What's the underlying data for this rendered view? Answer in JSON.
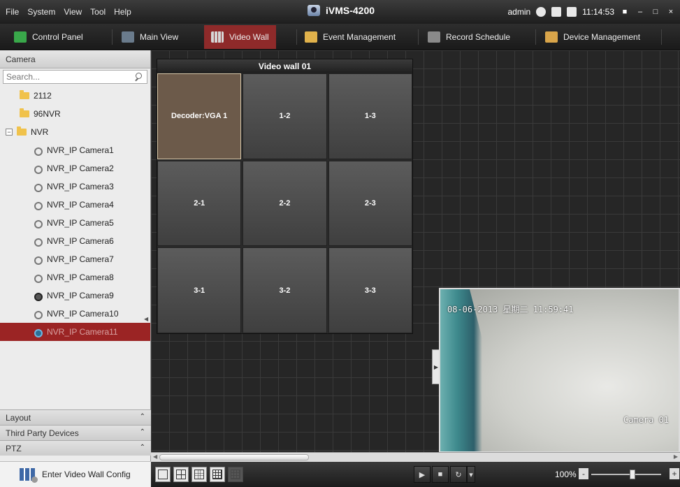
{
  "menu": [
    "File",
    "System",
    "View",
    "Tool",
    "Help"
  ],
  "app": {
    "title": "iVMS-4200"
  },
  "status": {
    "user": "admin",
    "time": "11:14:53"
  },
  "tabs": [
    {
      "label": "Control Panel",
      "icon": "control-panel-icon",
      "color": "#39a84a"
    },
    {
      "label": "Main View",
      "icon": "main-view-icon",
      "color": "#6a7b8c"
    },
    {
      "label": "Video Wall",
      "icon": "video-wall-icon",
      "color": "#c7c7c7",
      "active": true
    },
    {
      "label": "Event Management",
      "icon": "event-management-icon",
      "color": "#e1b24b"
    },
    {
      "label": "Record Schedule",
      "icon": "record-schedule-icon",
      "color": "#8a8a8a"
    },
    {
      "label": "Device Management",
      "icon": "device-management-icon",
      "color": "#d9a54a"
    }
  ],
  "left": {
    "header": "Camera",
    "search_placeholder": "Search...",
    "tree": [
      {
        "label": "2112",
        "type": "folder",
        "indent": 1
      },
      {
        "label": "96NVR",
        "type": "folder",
        "indent": 1
      },
      {
        "label": "NVR",
        "type": "folder",
        "indent": 0,
        "expanded": true
      },
      {
        "label": "NVR_IP Camera1",
        "type": "camera",
        "indent": 2
      },
      {
        "label": "NVR_IP Camera2",
        "type": "camera",
        "indent": 2
      },
      {
        "label": "NVR_IP Camera3",
        "type": "camera",
        "indent": 2
      },
      {
        "label": "NVR_IP Camera4",
        "type": "camera",
        "indent": 2
      },
      {
        "label": "NVR_IP Camera5",
        "type": "camera",
        "indent": 2
      },
      {
        "label": "NVR_IP Camera6",
        "type": "camera",
        "indent": 2
      },
      {
        "label": "NVR_IP Camera7",
        "type": "camera",
        "indent": 2
      },
      {
        "label": "NVR_IP Camera8",
        "type": "camera",
        "indent": 2
      },
      {
        "label": "NVR_IP Camera9",
        "type": "camera-dark",
        "indent": 2
      },
      {
        "label": "NVR_IP Camera10",
        "type": "camera",
        "indent": 2
      },
      {
        "label": "NVR_IP Camera11",
        "type": "camera-blue",
        "indent": 2,
        "selected": true
      }
    ],
    "accordions": [
      "Layout",
      "Third Party Devices",
      "PTZ"
    ],
    "wall_config_label": "Enter Video Wall Config"
  },
  "wall": {
    "title": "Video wall 01",
    "cells": [
      "Decoder:VGA 1",
      "1-2",
      "1-3",
      "2-1",
      "2-2",
      "2-3",
      "3-1",
      "3-2",
      "3-3"
    ],
    "active_cell": 0
  },
  "preview": {
    "timestamp": "08-06-2013 星期二 11:59:41",
    "camera_label": "Camera 01"
  },
  "zoom": {
    "label": "100%",
    "level_percent": 55
  }
}
